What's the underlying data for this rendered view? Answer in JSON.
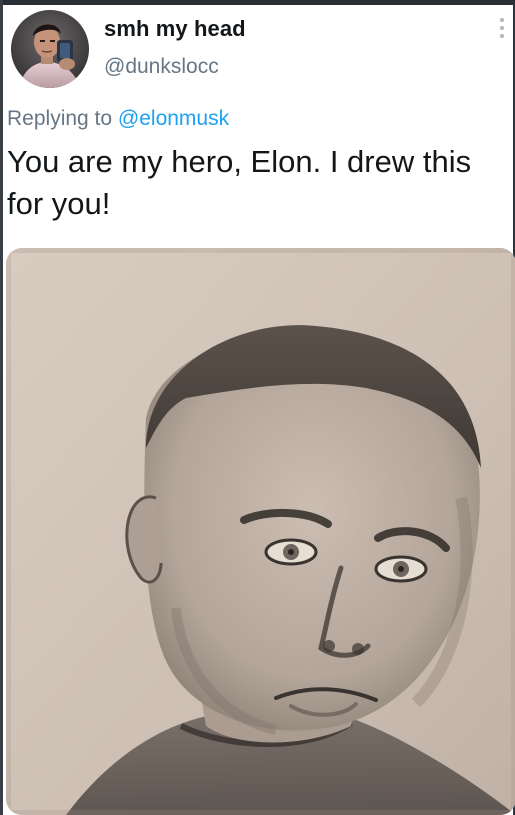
{
  "tweet": {
    "display_name": "smh my head",
    "handle": "@dunkslocc",
    "reply_prefix": "Replying to",
    "reply_mention": "@elonmusk",
    "text": "You are my hero, Elon. I drew this for you!",
    "more_icon": "vertical-ellipsis-icon",
    "media_alt": "pencil portrait drawing"
  },
  "colors": {
    "text_primary": "#14171a",
    "text_secondary": "#657786",
    "link": "#1da1f2"
  }
}
